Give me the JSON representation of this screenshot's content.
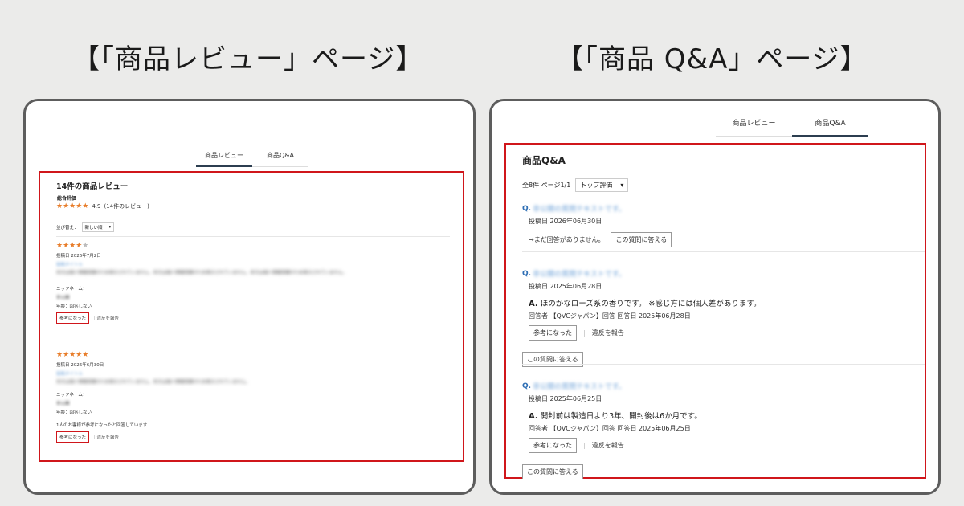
{
  "left_heading": "【「商品レビュー」ページ】",
  "right_heading": "【「商品 Q&A」ページ】",
  "tabs": [
    "商品レビュー",
    "商品Q&A"
  ],
  "review_page": {
    "title": "14件の商品レビュー",
    "overall_label": "総合評価",
    "stars": "★★★★★",
    "score": "4.9",
    "review_count": "(14件のレビュー)",
    "sort_label": "並び替え：",
    "sort_value": "新しい順",
    "reviews": [
      {
        "stars_on": "★★★★",
        "stars_off": "★",
        "posted": "投稿日 2026年7月2日",
        "heading": "投稿タイトル",
        "body": "本文は個人情報保護のため表示されていません。本文は個人情報保護のため表示されていません。本文は個人情報保護のため表示されていません。",
        "nickname_label": "ニックネーム：",
        "nickname": "非公開",
        "age": "年齢：回答しない",
        "helpful_note": "",
        "helpful_button": "参考になった",
        "report": "｜違反を報告"
      },
      {
        "stars_on": "★★★★★",
        "stars_off": "",
        "posted": "投稿日 2026年6月30日",
        "heading": "投稿タイトル",
        "body": "本文は個人情報保護のため表示されていません。本文は個人情報保護のため表示されていません。",
        "nickname_label": "ニックネーム：",
        "nickname": "非公開",
        "age": "年齢：回答しない",
        "helpful_note": "1人のお客様が参考になったと回答しています",
        "helpful_button": "参考になった",
        "report": "｜違反を報告"
      }
    ]
  },
  "qa_page": {
    "title": "商品Q&A",
    "meta": "全8件 ページ1/1",
    "sort_value": "トップ評価",
    "items": [
      {
        "q_mark": "Q.",
        "question": "非公開の質問テキストです。",
        "posted": "投稿日 2026年06月30日",
        "no_answer": "→まだ回答がありません。",
        "answer_button": "この質問に答える",
        "answer": "",
        "answerer": "",
        "helpful_button": "",
        "report": ""
      },
      {
        "q_mark": "Q.",
        "question": "非公開の質問テキストです。",
        "posted": "投稿日 2025年06月28日",
        "no_answer": "",
        "a_mark": "A.",
        "answer": "ほのかなローズ系の香りです。 ※感じ方には個人差があります。",
        "answerer": "回答者 【QVCジャパン】回答 回答日 2025年06月28日",
        "helpful_button": "参考になった",
        "report": "違反を報告",
        "answer_button": "この質問に答える"
      },
      {
        "q_mark": "Q.",
        "question": "非公開の質問テキストです。",
        "posted": "投稿日 2025年06月25日",
        "no_answer": "",
        "a_mark": "A.",
        "answer": "開封前は製造日より3年、開封後は6か月です。",
        "answerer": "回答者 【QVCジャパン】回答 回答日 2025年06月25日",
        "helpful_button": "参考になった",
        "report": "違反を報告",
        "answer_button": "この質問に答える"
      }
    ]
  }
}
